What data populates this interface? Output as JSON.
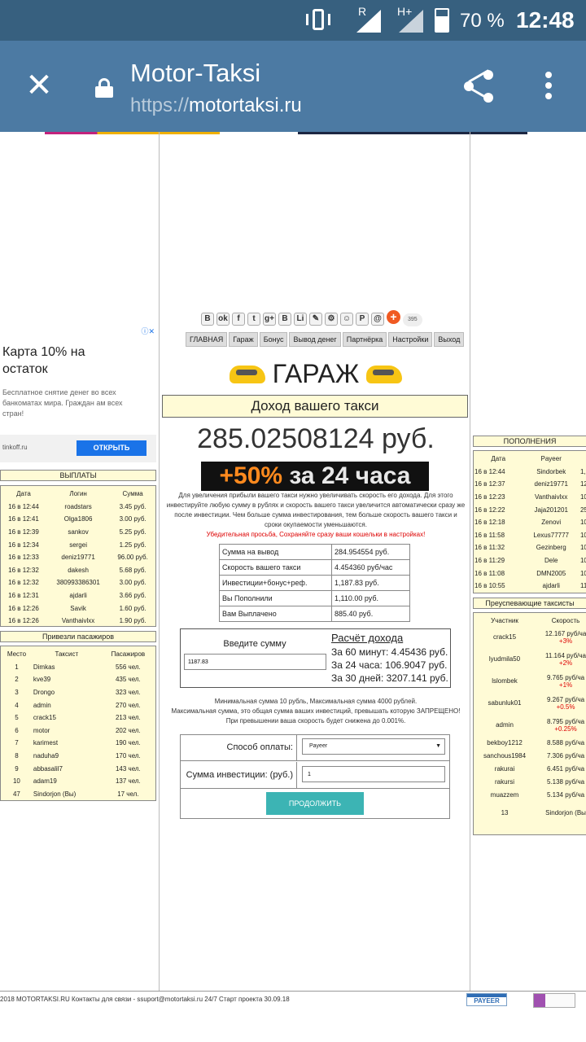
{
  "status": {
    "signal_r": "R",
    "signal_h": "H+",
    "battery": "70 %",
    "time": "12:48"
  },
  "toolbar": {
    "title": "Motor-Taksi",
    "url_scheme": "https://",
    "url_host": "motortaksi.ru"
  },
  "ad": {
    "title": "Карта 10% на остаток",
    "text": "Бесплатное снятие денег во всех банкоматах мира. Граждан ам всех стран!",
    "domain": "tinkoff.ru",
    "button": "ОТКРЫТЬ"
  },
  "share": {
    "count": "395"
  },
  "nav": [
    "ГЛАВНАЯ",
    "Гараж",
    "Бонус",
    "Вывод денег",
    "Партнёрка",
    "Настройки",
    "Выход"
  ],
  "garage": {
    "title": "ГАРАЖ",
    "subtitle": "Доход вашего такси",
    "balance": "285.02508124 руб.",
    "promo_plus": "+50%",
    "promo_rest": " за 24 часа",
    "description": "Для увеличения прибыли вашего такси нужно увеличивать скорость его дохода. Для этого инвестируйте любую сумму в рублях и скорость вашего такси увеличится автоматически сразу же после инвестиции. Чем больше сумма инвестирования, тем больше скорость вашего такси и сроки окупаемости уменьшаются.",
    "warning": "Убедительная просьба, Сохраняйте сразу ваши кошельки в настройках!"
  },
  "stats": [
    {
      "label": "Сумма на вывод",
      "value": "284.954554 руб."
    },
    {
      "label": "Скорость вашего такси",
      "value": "4.454360 руб/час"
    },
    {
      "label": "Инвестиции+бонус+реф.",
      "value": "1,187.83 руб."
    },
    {
      "label": "Вы Пополнили",
      "value": "1,110.00 руб."
    },
    {
      "label": "Вам Выплачено",
      "value": "885.40 руб."
    }
  ],
  "calc": {
    "prompt": "Введите сумму",
    "input_value": "1187.83",
    "title": "Расчёт дохода",
    "lines": [
      "За 60 минут: 4.45436 руб.",
      "За 24 часа: 106.9047 руб.",
      "За 30 дней: 3207.141 руб."
    ]
  },
  "rules": {
    "line1": "Минимальная сумма 10 рубль, Максимальная сумма 4000 рублей.",
    "line2": "Максимальная сумма, это общая сумма ваших инвестиций, превышать которую ЗАПРЕЩЕНО!",
    "line3": "При превышении ваша скорость будет снижена до 0.001%."
  },
  "payform": {
    "method_label": "Способ оплаты:",
    "method_value": "Payeer",
    "amount_label": "Сумма инвестиции: (руб.)",
    "amount_value": "1",
    "submit": "ПРОДОЛЖИТЬ"
  },
  "payouts": {
    "title": "ВЫПЛАТЫ",
    "headers": [
      "Дата",
      "Логин",
      "Сумма"
    ],
    "rows": [
      [
        "16 в 12:44",
        "roadstars",
        "3.45 руб."
      ],
      [
        "16 в 12:41",
        "Olga1806",
        "3.00 руб."
      ],
      [
        "16 в 12:39",
        "sankov",
        "5.25 руб."
      ],
      [
        "16 в 12:34",
        "sergei",
        "1.25 руб."
      ],
      [
        "16 в 12:33",
        "deniz19771",
        "96.00 руб."
      ],
      [
        "16 в 12:32",
        "dakesh",
        "5.68 руб."
      ],
      [
        "16 в 12:32",
        "380993386301",
        "3.00 руб."
      ],
      [
        "16 в 12:31",
        "ajdarli",
        "3.66 руб."
      ],
      [
        "16 в 12:26",
        "Savik",
        "1.60 руб."
      ],
      [
        "16 в 12:26",
        "Vanthaivlxx",
        "1.90 руб."
      ]
    ]
  },
  "passengers": {
    "title": "Привезли пасажиров",
    "headers": [
      "Место",
      "Таксист",
      "Пасажиров"
    ],
    "rows": [
      [
        "1",
        "Dimkas",
        "556 чел."
      ],
      [
        "2",
        "kve39",
        "435 чел."
      ],
      [
        "3",
        "Drongo",
        "323 чел."
      ],
      [
        "4",
        "admin",
        "270 чел."
      ],
      [
        "5",
        "crack15",
        "213 чел."
      ],
      [
        "6",
        "motor",
        "202 чел."
      ],
      [
        "7",
        "karimest",
        "190 чел."
      ],
      [
        "8",
        "naduha9",
        "170 чел."
      ],
      [
        "9",
        "abbasalil7",
        "143 чел."
      ],
      [
        "10",
        "adam19",
        "137 чел."
      ],
      [
        "47",
        "Sindorjon (Вы)",
        "17 чел."
      ]
    ]
  },
  "deposits": {
    "title": "ПОПОЛНЕНИЯ",
    "headers": [
      "Дата",
      "Payeer",
      ""
    ],
    "rows": [
      [
        "16 в 12:44",
        "Sindorbek",
        "1,1"
      ],
      [
        "16 в 12:37",
        "deniz19771",
        "12"
      ],
      [
        "16 в 12:23",
        "Vanthaivlxx",
        "10"
      ],
      [
        "16 в 12:22",
        "Jaja201201",
        "25"
      ],
      [
        "16 в 12:18",
        "Zenovi",
        "10"
      ],
      [
        "16 в 11:58",
        "Lexus77777",
        "10"
      ],
      [
        "16 в 11:32",
        "Gezinberg",
        "10"
      ],
      [
        "16 в 11:29",
        "Dele",
        "10"
      ],
      [
        "16 в 11:08",
        "DMN2005",
        "10"
      ],
      [
        "16 в 10:55",
        "ajdarli",
        "11"
      ]
    ]
  },
  "leaders": {
    "title": "Преуспевающие таксисты",
    "headers": [
      "Участник",
      "Скорость"
    ],
    "rows": [
      {
        "name": "crack15",
        "speed": "12.167 руб/ча",
        "delta": "+3%"
      },
      {
        "name": "lyudmila50",
        "speed": "11.164 руб/ча",
        "delta": "+2%"
      },
      {
        "name": "lslombek",
        "speed": "9.765 руб/ча",
        "delta": "+1%"
      },
      {
        "name": "sabunluk01",
        "speed": "9.267 руб/ча",
        "delta": "+0.5%"
      },
      {
        "name": "admin",
        "speed": "8.795 руб/ча",
        "delta": "+0.25%"
      },
      {
        "name": "bekboy1212",
        "speed": "8.588 руб/ча",
        "delta": ""
      },
      {
        "name": "sanchous1984",
        "speed": "7.306 руб/ча",
        "delta": ""
      },
      {
        "name": "rakurai",
        "speed": "6.451 руб/ча",
        "delta": ""
      },
      {
        "name": "rakursi",
        "speed": "5.138 руб/ча",
        "delta": ""
      },
      {
        "name": "muazzem",
        "speed": "5.134 руб/ча",
        "delta": ""
      },
      {
        "name": "13",
        "speed": "Sindorjon (Вы",
        "delta": ""
      }
    ]
  },
  "footer": {
    "text": "2018 MOTORTAKSI.RU Контакты для связи - ssuport@motortaksi.ru 24/7 Старт проекта 30.09.18",
    "payeer": "PAYEER"
  }
}
